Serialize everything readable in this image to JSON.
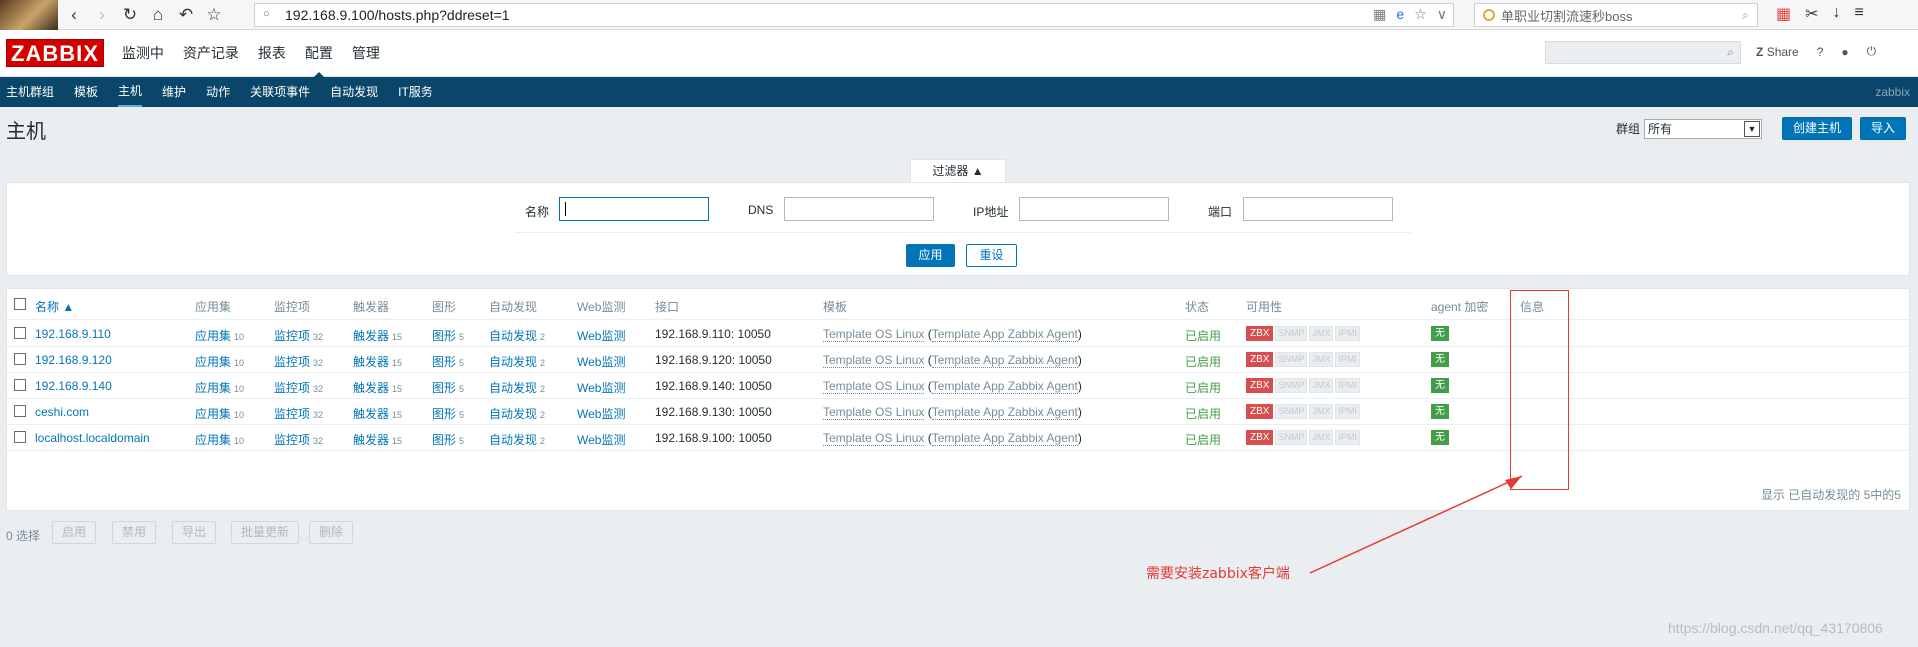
{
  "browser": {
    "url": "192.168.9.100/hosts.php?ddreset=1",
    "search_text": "单职业切割流速秒boss"
  },
  "header": {
    "logo": "ZABBIX",
    "menu": [
      "监测中",
      "资产记录",
      "报表",
      "配置",
      "管理"
    ],
    "active_menu": "配置",
    "share_label": "Share",
    "help_label": "?"
  },
  "submenu": {
    "items": [
      "主机群组",
      "模板",
      "主机",
      "维护",
      "动作",
      "关联项事件",
      "自动发现",
      "IT服务"
    ],
    "active": "主机",
    "user": "zabbix"
  },
  "page": {
    "title": "主机",
    "group_label": "群组",
    "group_value": "所有",
    "create_button": "创建主机",
    "import_button": "导入"
  },
  "filter": {
    "tab_label": "过滤器 ▲",
    "name_label": "名称",
    "dns_label": "DNS",
    "ip_label": "IP地址",
    "port_label": "端口",
    "apply": "应用",
    "reset": "重设"
  },
  "table": {
    "headers": {
      "name": "名称 ▲",
      "apps": "应用集",
      "items": "监控项",
      "triggers": "触发器",
      "graphs": "图形",
      "discovery": "自动发现",
      "web": "Web监测",
      "interface": "接口",
      "templates": "模板",
      "status": "状态",
      "availability": "可用性",
      "encryption": "agent 加密",
      "info": "信息"
    },
    "rows": [
      {
        "name": "192.168.9.110",
        "apps": "应用集",
        "apps_n": "10",
        "items": "监控项",
        "items_n": "32",
        "triggers": "触发器",
        "triggers_n": "15",
        "graphs": "图形",
        "graphs_n": "5",
        "discovery": "自动发现",
        "discovery_n": "2",
        "web": "Web监测",
        "interface": "192.168.9.110: 10050",
        "tmpl1": "Template OS Linux",
        "tmpl2": "Template App Zabbix Agent",
        "status": "已启用",
        "enc": "无"
      },
      {
        "name": "192.168.9.120",
        "apps": "应用集",
        "apps_n": "10",
        "items": "监控项",
        "items_n": "32",
        "triggers": "触发器",
        "triggers_n": "15",
        "graphs": "图形",
        "graphs_n": "5",
        "discovery": "自动发现",
        "discovery_n": "2",
        "web": "Web监测",
        "interface": "192.168.9.120: 10050",
        "tmpl1": "Template OS Linux",
        "tmpl2": "Template App Zabbix Agent",
        "status": "已启用",
        "enc": "无"
      },
      {
        "name": "192.168.9.140",
        "apps": "应用集",
        "apps_n": "10",
        "items": "监控项",
        "items_n": "32",
        "triggers": "触发器",
        "triggers_n": "15",
        "graphs": "图形",
        "graphs_n": "5",
        "discovery": "自动发现",
        "discovery_n": "2",
        "web": "Web监测",
        "interface": "192.168.9.140: 10050",
        "tmpl1": "Template OS Linux",
        "tmpl2": "Template App Zabbix Agent",
        "status": "已启用",
        "enc": "无"
      },
      {
        "name": "ceshi.com",
        "apps": "应用集",
        "apps_n": "10",
        "items": "监控项",
        "items_n": "32",
        "triggers": "触发器",
        "triggers_n": "15",
        "graphs": "图形",
        "graphs_n": "5",
        "discovery": "自动发现",
        "discovery_n": "2",
        "web": "Web监测",
        "interface": "192.168.9.130: 10050",
        "tmpl1": "Template OS Linux",
        "tmpl2": "Template App Zabbix Agent",
        "status": "已启用",
        "enc": "无"
      },
      {
        "name": "localhost.localdomain",
        "apps": "应用集",
        "apps_n": "10",
        "items": "监控项",
        "items_n": "32",
        "triggers": "触发器",
        "triggers_n": "15",
        "graphs": "图形",
        "graphs_n": "5",
        "discovery": "自动发现",
        "discovery_n": "2",
        "web": "Web监测",
        "interface": "192.168.9.100: 10050",
        "tmpl1": "Template OS Linux",
        "tmpl2": "Template App Zabbix Agent",
        "status": "已启用",
        "enc": "无"
      }
    ],
    "availability_tags": [
      "ZBX",
      "SNMP",
      "JMX",
      "IPMI"
    ],
    "footer": "显示 已自动发现的 5中的5"
  },
  "actions": {
    "selected": "0 选择",
    "buttons": [
      "启用",
      "禁用",
      "导出",
      "批量更新",
      "删除"
    ]
  },
  "annotation": "需要安装zabbix客户端",
  "watermark": "https://blog.csdn.net/qq_43170806",
  "colors": {
    "brand": "#d40000",
    "nav": "#0a466a",
    "link": "#0275b8",
    "ok": "#429e47",
    "zbx_down": "#d64e4e",
    "annotation": "#e53935"
  }
}
